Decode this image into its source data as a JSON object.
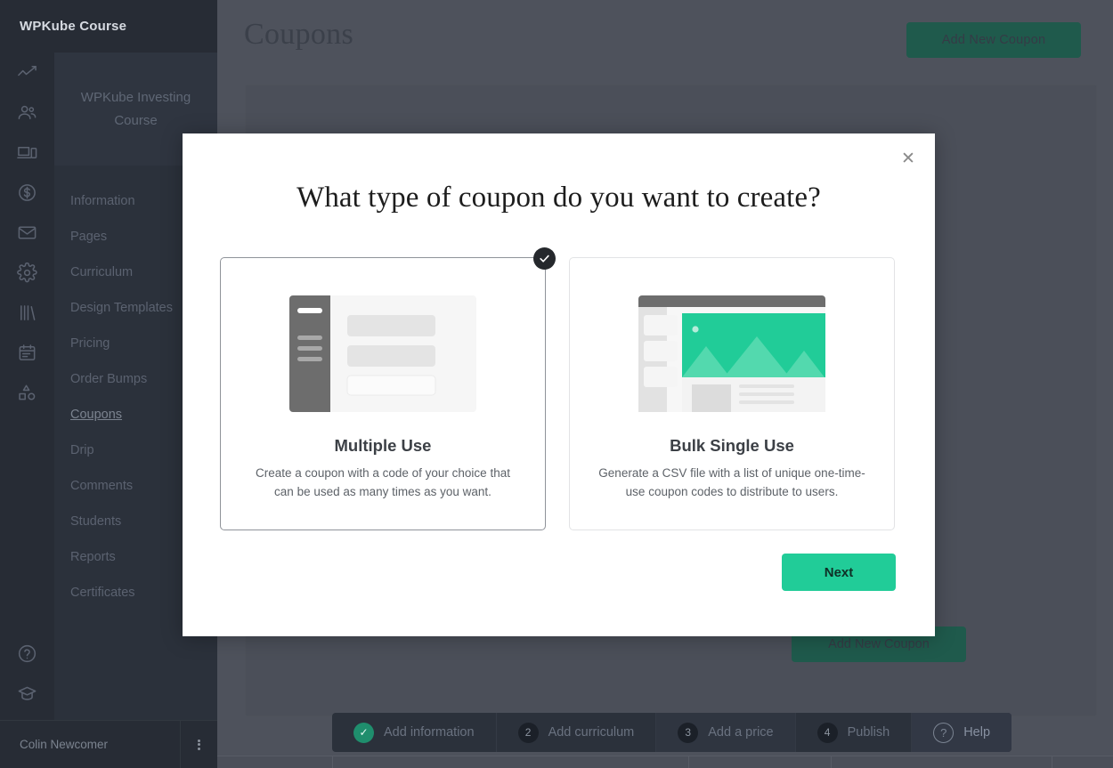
{
  "sidebar": {
    "brand": "WPKube Course",
    "course_title": "WPKube Investing Course",
    "rail_icons_top": [
      "chart-line-icon",
      "users-icon",
      "devices-icon",
      "dollar-circle-icon",
      "envelope-icon",
      "gear-icon",
      "books-icon",
      "calendar-icon",
      "shapes-icon"
    ],
    "rail_icons_bottom": [
      "help-circle-icon",
      "graduation-cap-icon"
    ],
    "items": [
      {
        "label": "Information",
        "active": false
      },
      {
        "label": "Pages",
        "active": false
      },
      {
        "label": "Curriculum",
        "active": false
      },
      {
        "label": "Design Templates",
        "active": false
      },
      {
        "label": "Pricing",
        "active": false
      },
      {
        "label": "Order Bumps",
        "active": false
      },
      {
        "label": "Coupons",
        "active": true
      },
      {
        "label": "Drip",
        "active": false
      },
      {
        "label": "Comments",
        "active": false
      },
      {
        "label": "Students",
        "active": false
      },
      {
        "label": "Reports",
        "active": false
      },
      {
        "label": "Certificates",
        "active": false
      }
    ],
    "user_name": "Colin Newcomer",
    "user_menu_icon": "kebab-menu-icon"
  },
  "page": {
    "title": "Coupons",
    "add_button_label": "Add New Coupon",
    "add_button_label_secondary": "Add New Coupon"
  },
  "steps": [
    {
      "badge": "✓",
      "label": "Add information",
      "done": true
    },
    {
      "badge": "2",
      "label": "Add curriculum",
      "done": false
    },
    {
      "badge": "3",
      "label": "Add a price",
      "done": false
    },
    {
      "badge": "4",
      "label": "Publish",
      "done": false
    }
  ],
  "help": {
    "label": "Help",
    "icon": "question-circle-icon"
  },
  "modal": {
    "close_icon": "close-icon",
    "title": "What type of coupon do you want to create?",
    "next_label": "Next",
    "options": [
      {
        "name": "Multiple Use",
        "description": "Create a coupon with a code of your choice that can be used as many times as you want.",
        "selected": true,
        "badge_icon": "check-icon",
        "thumb": "form-layout-thumbnail"
      },
      {
        "name": "Bulk Single Use",
        "description": "Generate a CSV file with a list of unique one-time-use coupon codes to distribute to users.",
        "selected": false,
        "thumb": "page-with-hero-image-thumbnail"
      }
    ]
  },
  "colors": {
    "accent_green": "#21cc98",
    "sidebar_dark": "#272c35",
    "sidebar_panel": "#2b313b",
    "overlay": "#4e525c",
    "badge_dark": "#25282c"
  }
}
